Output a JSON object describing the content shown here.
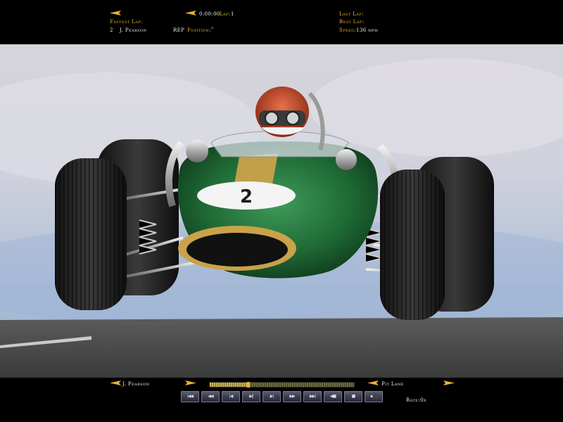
{
  "hud": {
    "timer": "0:00:00",
    "lap_label": "Lap:",
    "lap_value": "1",
    "fastest_lap_label": "Fastest Lap:",
    "fastest_lap_position": "2",
    "fastest_lap_driver": "J. Pearson",
    "rep_label": "REP",
    "position_label": "Position:",
    "position_value": "\"",
    "last_lap_label": "Last Lap:",
    "best_lap_label": "Best Lap:",
    "speed_label": "Speed:",
    "speed_value": "136 mph"
  },
  "car": {
    "number": "2"
  },
  "replay": {
    "driver": "J. Pearson",
    "camera": "Pit Lane",
    "rate_label": "Rate:",
    "rate_value": "0x",
    "progress": 0.27,
    "buttons": [
      {
        "icon": "skip-to-start-icon",
        "glyph": "|◀◀"
      },
      {
        "icon": "rewind-icon",
        "glyph": "◀◀"
      },
      {
        "icon": "step-back-icon",
        "glyph": "|◀"
      },
      {
        "icon": "play-pause-icon",
        "glyph": "▶||"
      },
      {
        "icon": "step-forward-icon",
        "glyph": "▶|"
      },
      {
        "icon": "fast-forward-icon",
        "glyph": "▶▶"
      },
      {
        "icon": "skip-to-end-icon",
        "glyph": "▶▶|"
      },
      {
        "icon": "prev-camera-icon",
        "glyph": "◀■"
      },
      {
        "icon": "stop-icon",
        "glyph": "■"
      },
      {
        "icon": "save-icon",
        "glyph": "▪⬛"
      }
    ]
  },
  "colors": {
    "hud_gold": "#e8b534",
    "hud_text": "#f2f2f2",
    "car_green": "#1f6b35",
    "car_stripe": "#c9a24a"
  }
}
